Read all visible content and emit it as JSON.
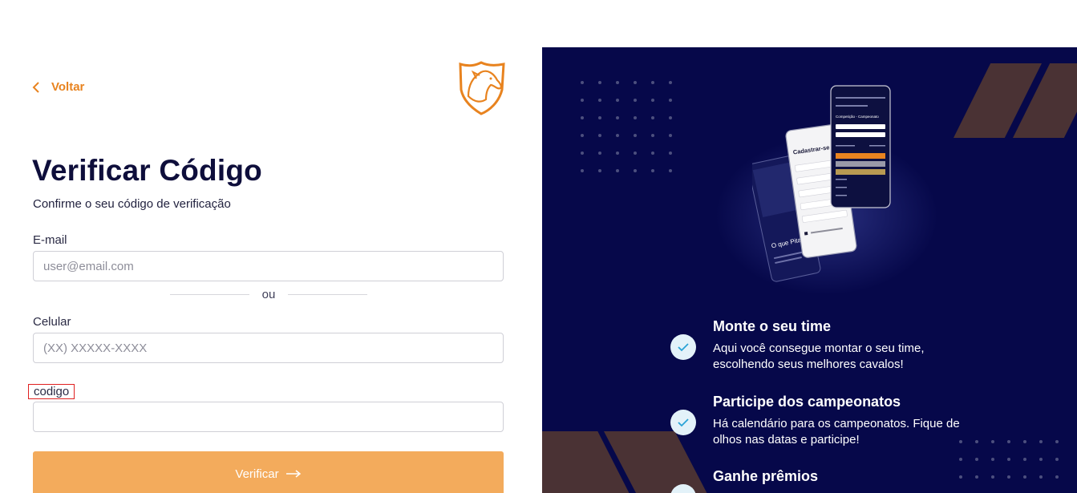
{
  "back": {
    "label": "Voltar"
  },
  "form": {
    "title": "Verificar Código",
    "subtitle": "Confirme o seu código de verificação",
    "email_label": "E-mail",
    "email_placeholder": "user@email.com",
    "divider_text": "ou",
    "phone_label": "Celular",
    "phone_placeholder": "(XX) XXXXX-XXXX",
    "code_label": "codigo",
    "code_value": "",
    "submit_label": "Verificar"
  },
  "mockup": {
    "screen_title": "Cadastrar-se",
    "screen_caption": "O que Pitaiero?",
    "ranking_title": "Competição - Campeonato"
  },
  "features": [
    {
      "title": "Monte o seu time",
      "text": "Aqui você consegue montar o seu time, escolhendo seus melhores cavalos!"
    },
    {
      "title": "Participe dos campeonatos",
      "text": "Há calendário para os campeonatos. Fique de olhos nas datas e participe!"
    },
    {
      "title": "Ganhe prêmios",
      "text": ""
    }
  ],
  "colors": {
    "accent": "#e8831f",
    "button": "#f3ab5c",
    "panel_bg": "#06084a",
    "title": "#0e0e3b",
    "check_bg": "#e3f2f9",
    "check_icon": "#29a3d6",
    "shape": "#4a3234"
  },
  "icons": {
    "back": "chevron-left-icon",
    "logo": "horse-shield-logo",
    "submit": "arrow-right-icon",
    "feature": "check-icon"
  }
}
